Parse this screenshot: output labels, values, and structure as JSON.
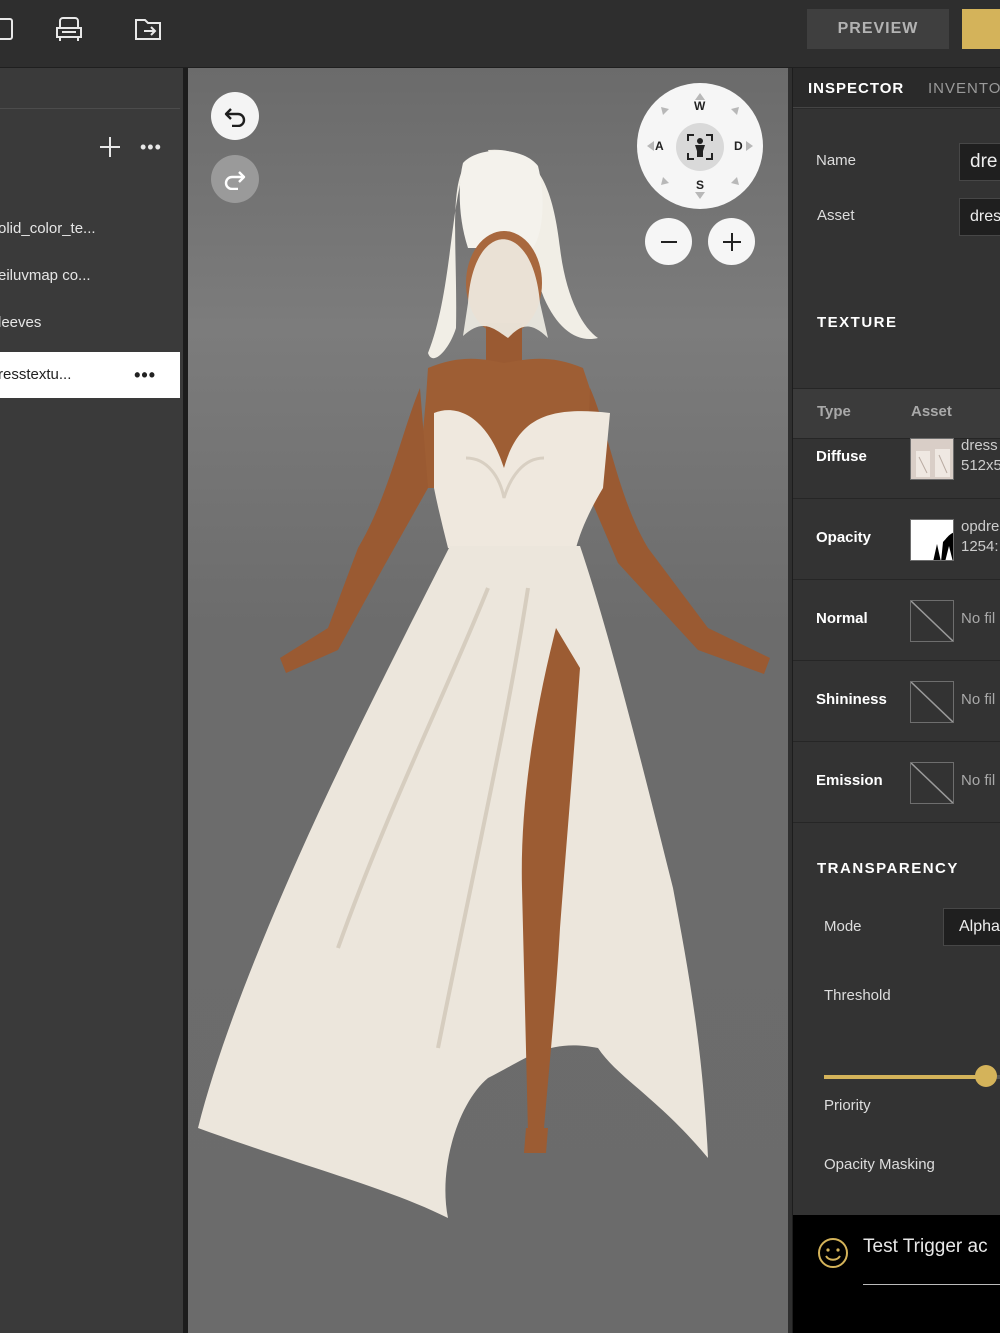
{
  "toolbar": {
    "preview_label": "PREVIEW",
    "icons": [
      "panel-icon",
      "sofa-icon",
      "export-folder-icon"
    ]
  },
  "layers": {
    "items": [
      {
        "label": "olid_color_te..."
      },
      {
        "label": "eiluvmap co..."
      },
      {
        "label": "leeves"
      },
      {
        "label": "resstextu...",
        "selected": true,
        "more": "•••"
      }
    ],
    "more_label": "•••"
  },
  "viewport": {
    "compass": {
      "north": "W",
      "south": "S",
      "west": "A",
      "east": "D"
    },
    "zoom_out": "−",
    "zoom_in": "+"
  },
  "inspector": {
    "tabs": [
      {
        "label": "INSPECTOR",
        "active": true
      },
      {
        "label": "INVENTO"
      }
    ],
    "name_label": "Name",
    "name_value": "dre",
    "asset_label": "Asset",
    "asset_value": "dres",
    "texture_title": "TEXTURE",
    "texture_header": {
      "type": "Type",
      "asset": "Asset"
    },
    "textures": [
      {
        "type": "Diffuse",
        "file": "dress",
        "size": "512x5"
      },
      {
        "type": "Opacity",
        "file": "opdre",
        "size": "1254:"
      },
      {
        "type": "Normal",
        "file": "No fil"
      },
      {
        "type": "Shininess",
        "file": "No fil"
      },
      {
        "type": "Emission",
        "file": "No fil"
      }
    ],
    "transparency_title": "TRANSPARENCY",
    "mode_label": "Mode",
    "mode_value": "Alpha",
    "threshold_label": "Threshold",
    "threshold_value": 0.9,
    "priority_label": "Priority",
    "opacity_masking_label": "Opacity Masking"
  },
  "trigger": {
    "text": "Test Trigger ac"
  },
  "colors": {
    "accent": "#d4b35a",
    "panel": "#333333",
    "selected_row": "#ffffff"
  }
}
